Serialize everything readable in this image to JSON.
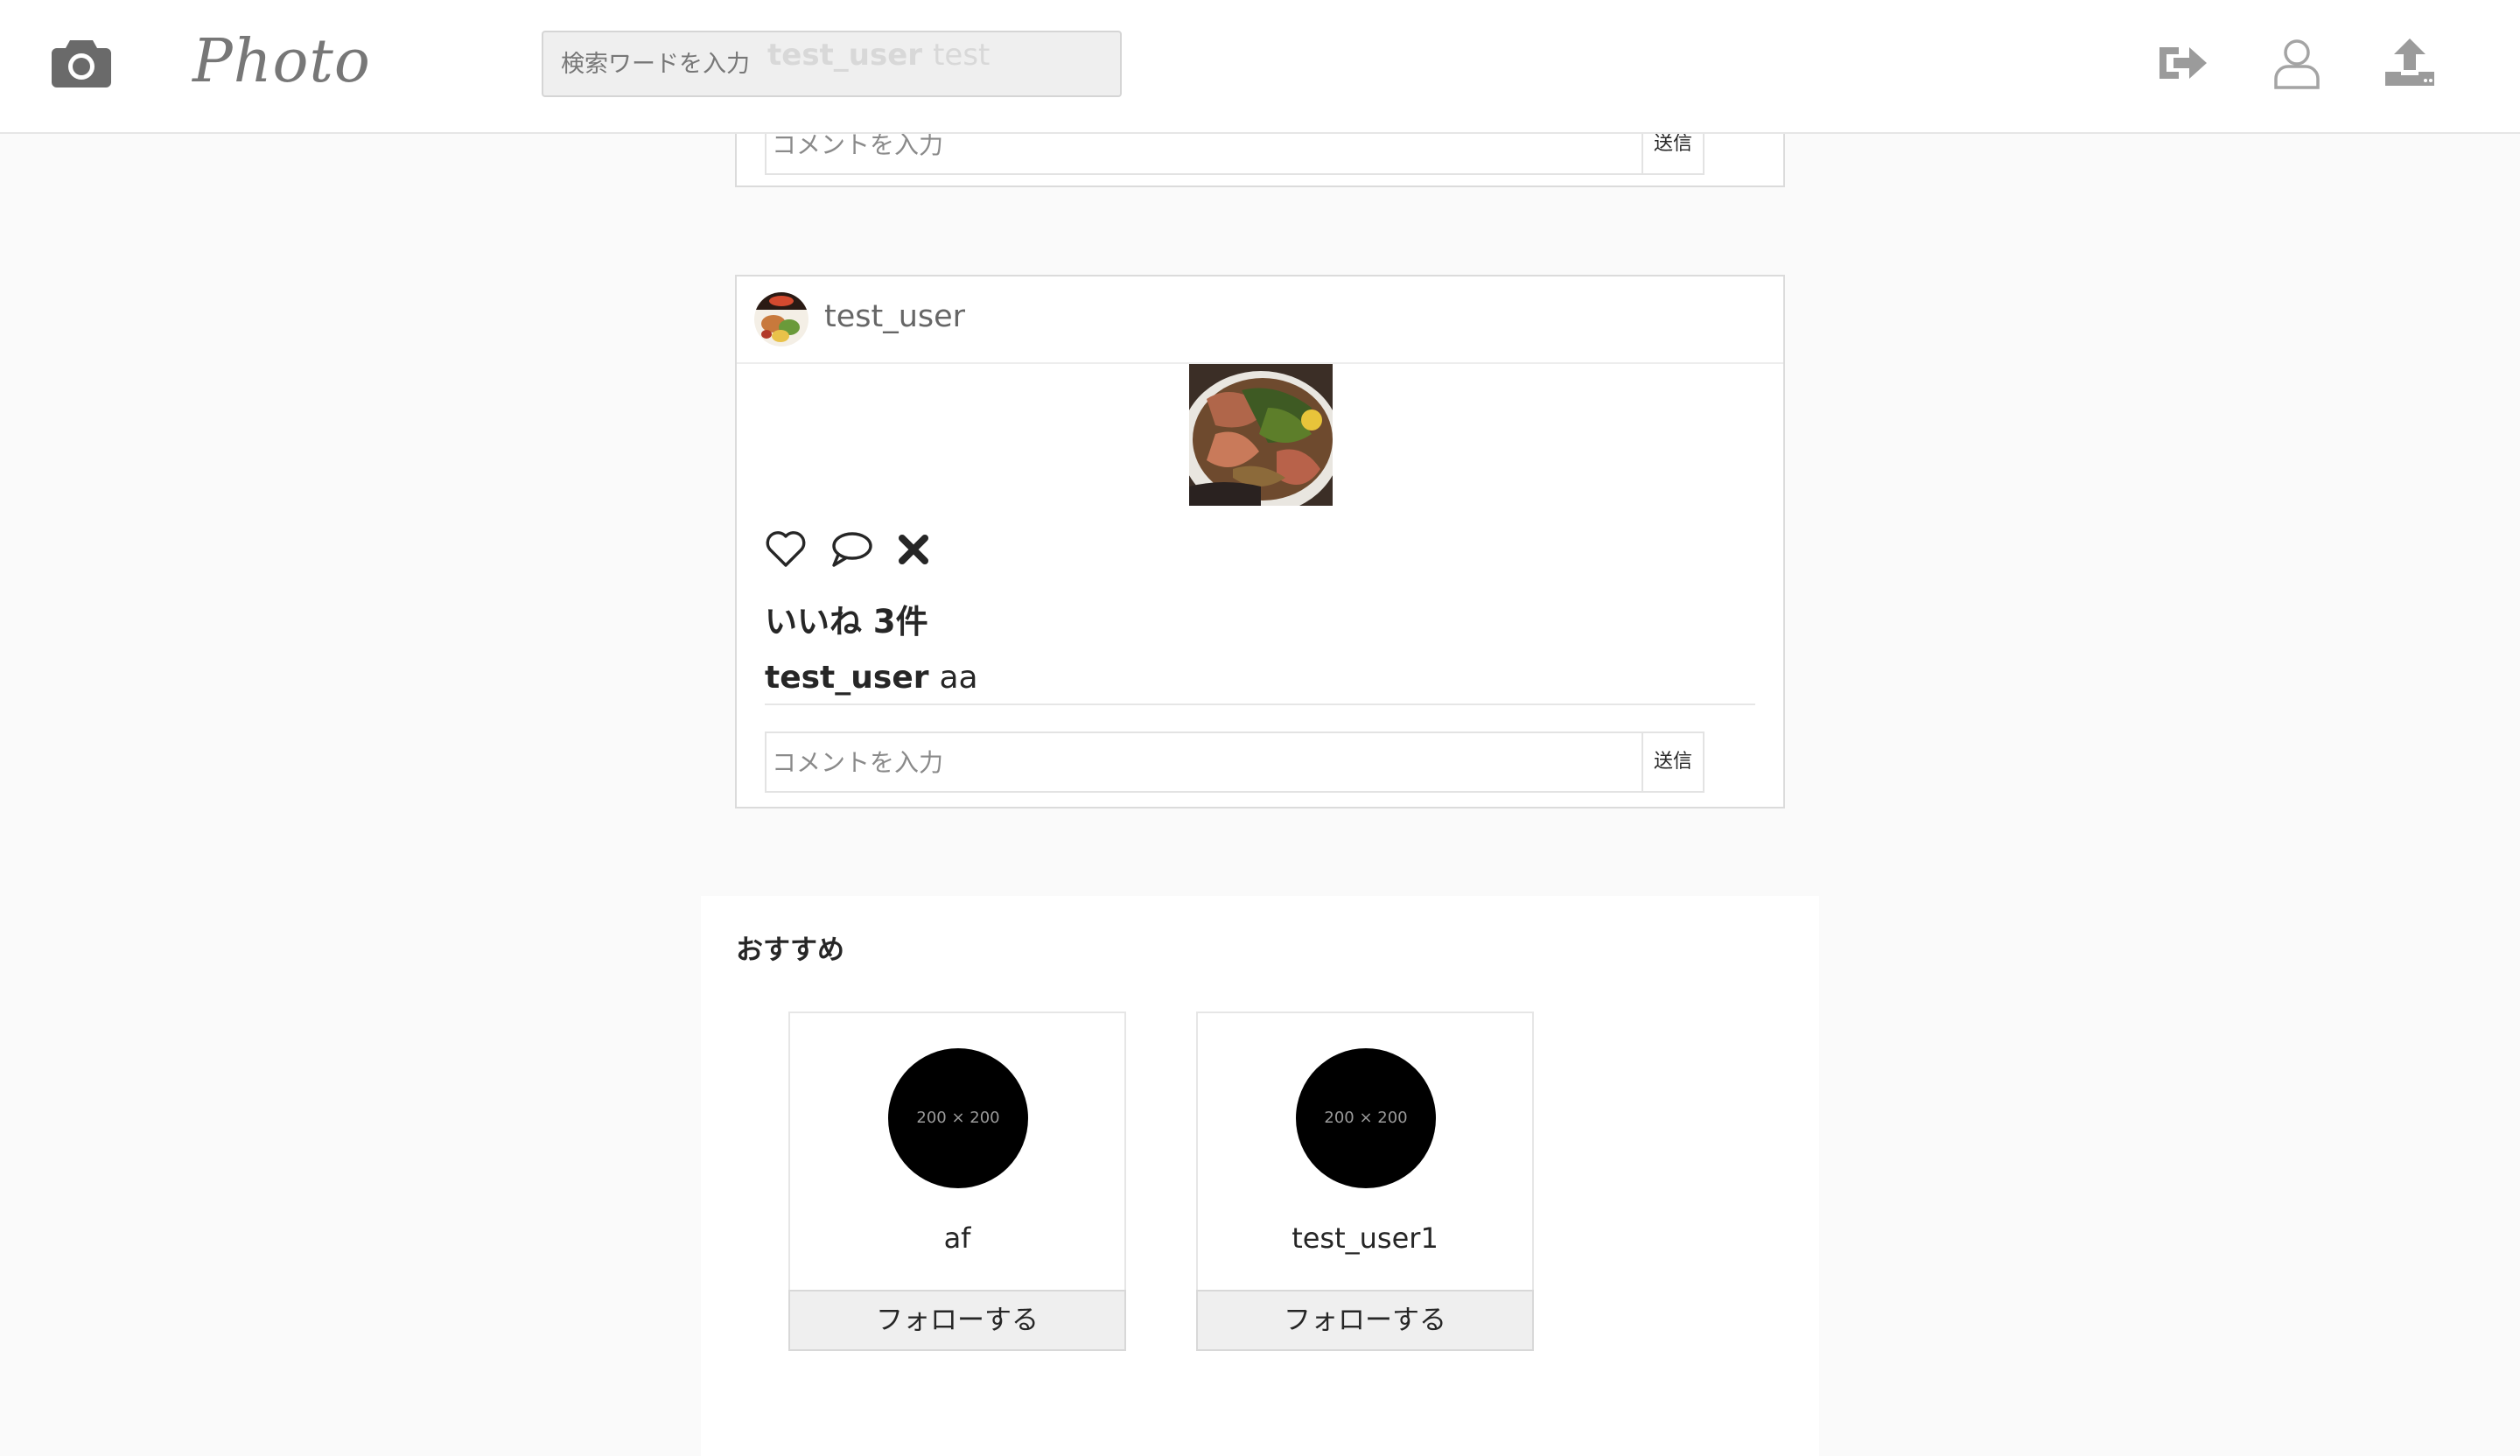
{
  "header": {
    "logo_text": "Photo",
    "search": {
      "placeholder": "検索ワードを入力",
      "ghost_user": "test_user",
      "ghost_caption": "test"
    },
    "icons": [
      "camera-icon",
      "logout-icon",
      "profile-icon",
      "upload-icon"
    ]
  },
  "posts": [
    {
      "comment_placeholder": "コメントを入力",
      "send_label": "送信"
    },
    {
      "username": "test_user",
      "likes_label": "いいね 3件",
      "caption_user": "test_user",
      "caption_text": "aa",
      "comment_placeholder": "コメントを入力",
      "send_label": "送信",
      "actions": [
        "heart-icon",
        "comment-icon",
        "delete-icon"
      ]
    }
  ],
  "recommend": {
    "title": "おすすめ",
    "users": [
      {
        "avatar_text": "200 × 200",
        "name": "af",
        "follow_label": "フォローする"
      },
      {
        "avatar_text": "200 × 200",
        "name": "test_user1",
        "follow_label": "フォローする"
      }
    ]
  },
  "colors": {
    "background": "#fafafa",
    "card_border": "#dbdbdb",
    "icon_gray": "#8e8e8e",
    "text": "#262626"
  }
}
